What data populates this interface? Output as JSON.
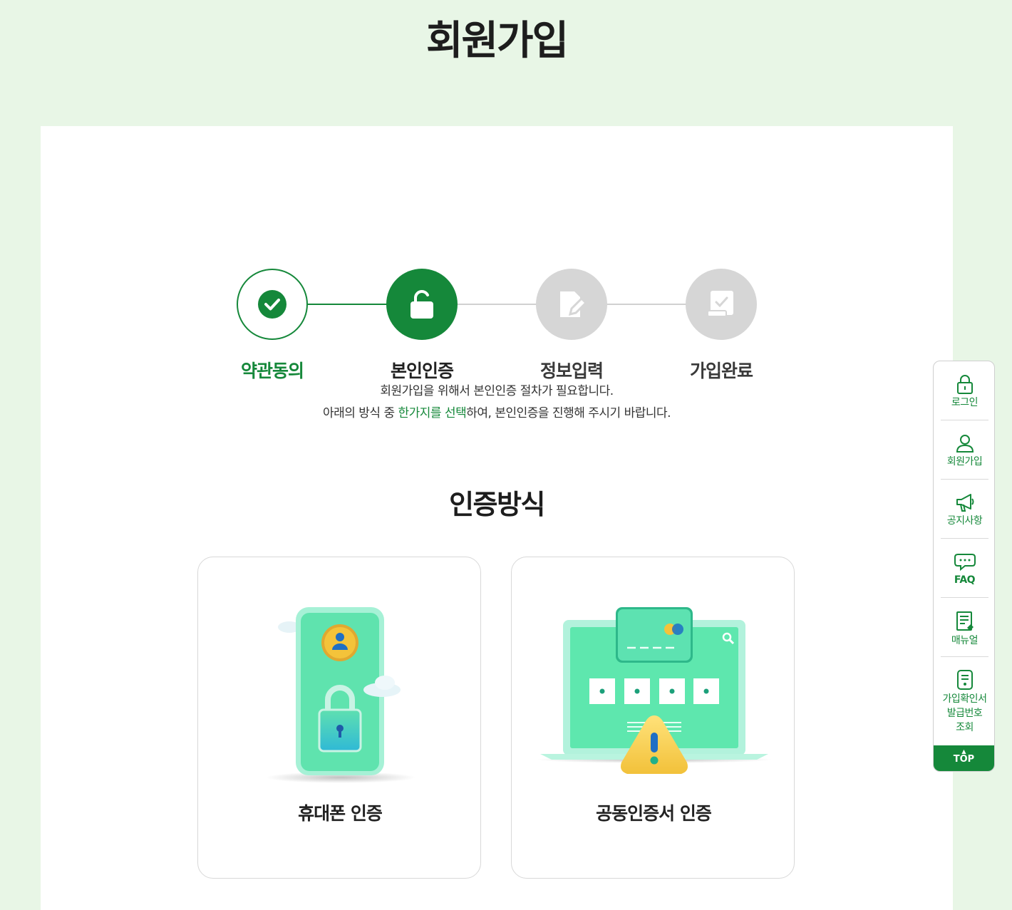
{
  "page": {
    "title": "회원가입"
  },
  "steps": [
    {
      "label": "약관동의",
      "state": "done",
      "icon": "check-icon"
    },
    {
      "label": "본인인증",
      "state": "active",
      "icon": "unlock-icon"
    },
    {
      "label": "정보입력",
      "state": "todo",
      "icon": "edit-document-icon"
    },
    {
      "label": "가입완료",
      "state": "todo",
      "icon": "completed-document-icon"
    }
  ],
  "intro": {
    "line1": "회원가입을 위해서 본인인증 절차가 필요합니다.",
    "line2_prefix": "아래의 방식 중 ",
    "line2_highlight": "한가지를 선택",
    "line2_suffix": "하여, 본인인증을 진행해 주시기 바랍니다."
  },
  "method": {
    "title": "인증방식",
    "options": [
      {
        "label": "휴대폰 인증",
        "icon": "phone-lock-illustration"
      },
      {
        "label": "공동인증서 인증",
        "icon": "laptop-certificate-illustration"
      }
    ]
  },
  "quick_menu": {
    "items": [
      {
        "label": "로그인",
        "icon": "lock-icon"
      },
      {
        "label": "회원가입",
        "icon": "user-icon"
      },
      {
        "label": "공지사항",
        "icon": "megaphone-icon"
      },
      {
        "label": "FAQ",
        "icon": "chat-bubble-icon"
      },
      {
        "label": "매뉴얼",
        "icon": "manual-icon"
      },
      {
        "label_lines": [
          "가입확인서",
          "발급번호",
          "조회"
        ],
        "icon": "receipt-icon"
      }
    ],
    "top_label": "TOP"
  },
  "colors": {
    "accent": "#15883a",
    "background": "#e8f6e6",
    "inactive": "#d6d6d6"
  }
}
